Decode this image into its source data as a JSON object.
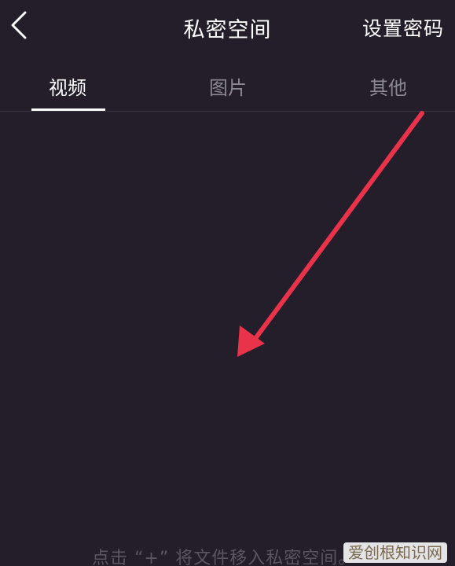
{
  "header": {
    "title": "私密空间",
    "set_password_label": "设置密码"
  },
  "tabs": [
    {
      "label": "视频",
      "active": true
    },
    {
      "label": "图片",
      "active": false
    },
    {
      "label": "其他",
      "active": false
    }
  ],
  "empty_state": {
    "hint": "点击 “+” 将文件移入私密空间。"
  },
  "watermark": {
    "text": "爱创根知识网"
  },
  "colors": {
    "background": "#231e2a",
    "active_tab": "#ffffff",
    "inactive_tab": "#8c8893",
    "annotation_arrow": "#e8334a"
  },
  "icons": {
    "back": "chevron-left-icon"
  }
}
